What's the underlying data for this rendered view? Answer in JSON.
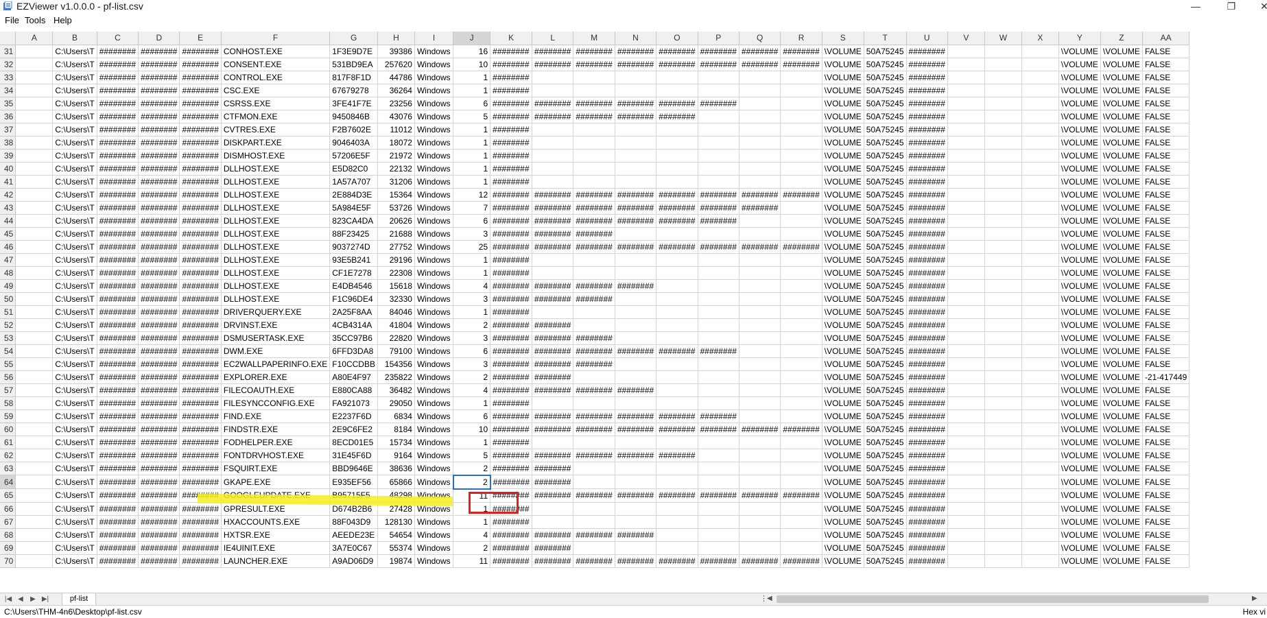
{
  "window": {
    "title": "EZViewer v1.0.0.0 - pf-list.csv",
    "controls": [
      "—",
      "❐",
      "✕"
    ]
  },
  "menu": [
    "File",
    "Tools",
    "Help"
  ],
  "columns": [
    "A",
    "B",
    "C",
    "D",
    "E",
    "F",
    "G",
    "H",
    "I",
    "J",
    "K",
    "L",
    "M",
    "N",
    "O",
    "P",
    "Q",
    "R",
    "S",
    "T",
    "U",
    "V",
    "W",
    "X",
    "Y",
    "Z",
    "AA"
  ],
  "active_column": "J",
  "active_row": "64",
  "rows": [
    [
      "31",
      "",
      "C:\\Users\\T",
      "########",
      "########",
      "########",
      "CONHOST.EXE",
      "1F3E9D7E",
      "39386",
      "Windows",
      "16",
      "########",
      "########",
      "########",
      "########",
      "########",
      "########",
      "########",
      "########",
      "\\VOLUME",
      "50A75245",
      "########",
      "",
      "",
      "",
      "\\VOLUME",
      "\\VOLUME",
      "FALSE"
    ],
    [
      "32",
      "",
      "C:\\Users\\T",
      "########",
      "########",
      "########",
      "CONSENT.EXE",
      "531BD9EA",
      "257620",
      "Windows",
      "10",
      "########",
      "########",
      "########",
      "########",
      "########",
      "########",
      "########",
      "########",
      "\\VOLUME",
      "50A75245",
      "########",
      "",
      "",
      "",
      "\\VOLUME",
      "\\VOLUME",
      "FALSE"
    ],
    [
      "33",
      "",
      "C:\\Users\\T",
      "########",
      "########",
      "########",
      "CONTROL.EXE",
      "817F8F1D",
      "44786",
      "Windows",
      "1",
      "########",
      "",
      "",
      "",
      "",
      "",
      "",
      "",
      "\\VOLUME",
      "50A75245",
      "########",
      "",
      "",
      "",
      "\\VOLUME",
      "\\VOLUME",
      "FALSE"
    ],
    [
      "34",
      "",
      "C:\\Users\\T",
      "########",
      "########",
      "########",
      "CSC.EXE",
      "67679278",
      "36264",
      "Windows",
      "1",
      "########",
      "",
      "",
      "",
      "",
      "",
      "",
      "",
      "\\VOLUME",
      "50A75245",
      "########",
      "",
      "",
      "",
      "\\VOLUME",
      "\\VOLUME",
      "FALSE"
    ],
    [
      "35",
      "",
      "C:\\Users\\T",
      "########",
      "########",
      "########",
      "CSRSS.EXE",
      "3FE41F7E",
      "23256",
      "Windows",
      "6",
      "########",
      "########",
      "########",
      "########",
      "########",
      "########",
      "",
      "",
      "\\VOLUME",
      "50A75245",
      "########",
      "",
      "",
      "",
      "\\VOLUME",
      "\\VOLUME",
      "FALSE"
    ],
    [
      "36",
      "",
      "C:\\Users\\T",
      "########",
      "########",
      "########",
      "CTFMON.EXE",
      "9450846B",
      "43076",
      "Windows",
      "5",
      "########",
      "########",
      "########",
      "########",
      "########",
      "",
      "",
      "",
      "\\VOLUME",
      "50A75245",
      "########",
      "",
      "",
      "",
      "\\VOLUME",
      "\\VOLUME",
      "FALSE"
    ],
    [
      "37",
      "",
      "C:\\Users\\T",
      "########",
      "########",
      "########",
      "CVTRES.EXE",
      "F2B7602E",
      "11012",
      "Windows",
      "1",
      "########",
      "",
      "",
      "",
      "",
      "",
      "",
      "",
      "\\VOLUME",
      "50A75245",
      "########",
      "",
      "",
      "",
      "\\VOLUME",
      "\\VOLUME",
      "FALSE"
    ],
    [
      "38",
      "",
      "C:\\Users\\T",
      "########",
      "########",
      "########",
      "DISKPART.EXE",
      "9046403A",
      "18072",
      "Windows",
      "1",
      "########",
      "",
      "",
      "",
      "",
      "",
      "",
      "",
      "\\VOLUME",
      "50A75245",
      "########",
      "",
      "",
      "",
      "\\VOLUME",
      "\\VOLUME",
      "FALSE"
    ],
    [
      "39",
      "",
      "C:\\Users\\T",
      "########",
      "########",
      "########",
      "DISMHOST.EXE",
      "57206E5F",
      "21972",
      "Windows",
      "1",
      "########",
      "",
      "",
      "",
      "",
      "",
      "",
      "",
      "\\VOLUME",
      "50A75245",
      "########",
      "",
      "",
      "",
      "\\VOLUME",
      "\\VOLUME",
      "FALSE"
    ],
    [
      "40",
      "",
      "C:\\Users\\T",
      "########",
      "########",
      "########",
      "DLLHOST.EXE",
      "E5D82C0",
      "22132",
      "Windows",
      "1",
      "########",
      "",
      "",
      "",
      "",
      "",
      "",
      "",
      "\\VOLUME",
      "50A75245",
      "########",
      "",
      "",
      "",
      "\\VOLUME",
      "\\VOLUME",
      "FALSE"
    ],
    [
      "41",
      "",
      "C:\\Users\\T",
      "########",
      "########",
      "########",
      "DLLHOST.EXE",
      "1A57A707",
      "31206",
      "Windows",
      "1",
      "########",
      "",
      "",
      "",
      "",
      "",
      "",
      "",
      "\\VOLUME",
      "50A75245",
      "########",
      "",
      "",
      "",
      "\\VOLUME",
      "\\VOLUME",
      "FALSE"
    ],
    [
      "42",
      "",
      "C:\\Users\\T",
      "########",
      "########",
      "########",
      "DLLHOST.EXE",
      "2E884D3E",
      "15364",
      "Windows",
      "12",
      "########",
      "########",
      "########",
      "########",
      "########",
      "########",
      "########",
      "########",
      "\\VOLUME",
      "50A75245",
      "########",
      "",
      "",
      "",
      "\\VOLUME",
      "\\VOLUME",
      "FALSE"
    ],
    [
      "43",
      "",
      "C:\\Users\\T",
      "########",
      "########",
      "########",
      "DLLHOST.EXE",
      "5A984E5F",
      "53726",
      "Windows",
      "7",
      "########",
      "########",
      "########",
      "########",
      "########",
      "########",
      "########",
      "",
      "\\VOLUME",
      "50A75245",
      "########",
      "",
      "",
      "",
      "\\VOLUME",
      "\\VOLUME",
      "FALSE"
    ],
    [
      "44",
      "",
      "C:\\Users\\T",
      "########",
      "########",
      "########",
      "DLLHOST.EXE",
      "823CA4DA",
      "20626",
      "Windows",
      "6",
      "########",
      "########",
      "########",
      "########",
      "########",
      "########",
      "",
      "",
      "\\VOLUME",
      "50A75245",
      "########",
      "",
      "",
      "",
      "\\VOLUME",
      "\\VOLUME",
      "FALSE"
    ],
    [
      "45",
      "",
      "C:\\Users\\T",
      "########",
      "########",
      "########",
      "DLLHOST.EXE",
      "88F23425",
      "21688",
      "Windows",
      "3",
      "########",
      "########",
      "########",
      "",
      "",
      "",
      "",
      "",
      "\\VOLUME",
      "50A75245",
      "########",
      "",
      "",
      "",
      "\\VOLUME",
      "\\VOLUME",
      "FALSE"
    ],
    [
      "46",
      "",
      "C:\\Users\\T",
      "########",
      "########",
      "########",
      "DLLHOST.EXE",
      "9037274D",
      "27752",
      "Windows",
      "25",
      "########",
      "########",
      "########",
      "########",
      "########",
      "########",
      "########",
      "########",
      "\\VOLUME",
      "50A75245",
      "########",
      "",
      "",
      "",
      "\\VOLUME",
      "\\VOLUME",
      "FALSE"
    ],
    [
      "47",
      "",
      "C:\\Users\\T",
      "########",
      "########",
      "########",
      "DLLHOST.EXE",
      "93E5B241",
      "29196",
      "Windows",
      "1",
      "########",
      "",
      "",
      "",
      "",
      "",
      "",
      "",
      "\\VOLUME",
      "50A75245",
      "########",
      "",
      "",
      "",
      "\\VOLUME",
      "\\VOLUME",
      "FALSE"
    ],
    [
      "48",
      "",
      "C:\\Users\\T",
      "########",
      "########",
      "########",
      "DLLHOST.EXE",
      "CF1E7278",
      "22308",
      "Windows",
      "1",
      "########",
      "",
      "",
      "",
      "",
      "",
      "",
      "",
      "\\VOLUME",
      "50A75245",
      "########",
      "",
      "",
      "",
      "\\VOLUME",
      "\\VOLUME",
      "FALSE"
    ],
    [
      "49",
      "",
      "C:\\Users\\T",
      "########",
      "########",
      "########",
      "DLLHOST.EXE",
      "E4DB4546",
      "15618",
      "Windows",
      "4",
      "########",
      "########",
      "########",
      "########",
      "",
      "",
      "",
      "",
      "\\VOLUME",
      "50A75245",
      "########",
      "",
      "",
      "",
      "\\VOLUME",
      "\\VOLUME",
      "FALSE"
    ],
    [
      "50",
      "",
      "C:\\Users\\T",
      "########",
      "########",
      "########",
      "DLLHOST.EXE",
      "F1C96DE4",
      "32330",
      "Windows",
      "3",
      "########",
      "########",
      "########",
      "",
      "",
      "",
      "",
      "",
      "\\VOLUME",
      "50A75245",
      "########",
      "",
      "",
      "",
      "\\VOLUME",
      "\\VOLUME",
      "FALSE"
    ],
    [
      "51",
      "",
      "C:\\Users\\T",
      "########",
      "########",
      "########",
      "DRIVERQUERY.EXE",
      "2A25F8AA",
      "84046",
      "Windows",
      "1",
      "########",
      "",
      "",
      "",
      "",
      "",
      "",
      "",
      "\\VOLUME",
      "50A75245",
      "########",
      "",
      "",
      "",
      "\\VOLUME",
      "\\VOLUME",
      "FALSE"
    ],
    [
      "52",
      "",
      "C:\\Users\\T",
      "########",
      "########",
      "########",
      "DRVINST.EXE",
      "4CB4314A",
      "41804",
      "Windows",
      "2",
      "########",
      "########",
      "",
      "",
      "",
      "",
      "",
      "",
      "\\VOLUME",
      "50A75245",
      "########",
      "",
      "",
      "",
      "\\VOLUME",
      "\\VOLUME",
      "FALSE"
    ],
    [
      "53",
      "",
      "C:\\Users\\T",
      "########",
      "########",
      "########",
      "DSMUSERTASK.EXE",
      "35CC97B6",
      "22820",
      "Windows",
      "3",
      "########",
      "########",
      "########",
      "",
      "",
      "",
      "",
      "",
      "\\VOLUME",
      "50A75245",
      "########",
      "",
      "",
      "",
      "\\VOLUME",
      "\\VOLUME",
      "FALSE"
    ],
    [
      "54",
      "",
      "C:\\Users\\T",
      "########",
      "########",
      "########",
      "DWM.EXE",
      "6FFD3DA8",
      "79100",
      "Windows",
      "6",
      "########",
      "########",
      "########",
      "########",
      "########",
      "########",
      "",
      "",
      "\\VOLUME",
      "50A75245",
      "########",
      "",
      "",
      "",
      "\\VOLUME",
      "\\VOLUME",
      "FALSE"
    ],
    [
      "55",
      "",
      "C:\\Users\\T",
      "########",
      "########",
      "########",
      "EC2WALLPAPERINFO.EXE",
      "F10CCDBB",
      "154356",
      "Windows",
      "3",
      "########",
      "########",
      "########",
      "",
      "",
      "",
      "",
      "",
      "\\VOLUME",
      "50A75245",
      "########",
      "",
      "",
      "",
      "\\VOLUME",
      "\\VOLUME",
      "FALSE"
    ],
    [
      "56",
      "",
      "C:\\Users\\T",
      "########",
      "########",
      "########",
      "EXPLORER.EXE",
      "A80E4F97",
      "235822",
      "Windows",
      "2",
      "########",
      "########",
      "",
      "",
      "",
      "",
      "",
      "",
      "\\VOLUME",
      "50A75245",
      "########",
      "",
      "",
      "",
      "\\VOLUME",
      "\\VOLUME",
      "-21-417449"
    ],
    [
      "57",
      "",
      "C:\\Users\\T",
      "########",
      "########",
      "########",
      "FILECOAUTH.EXE",
      "E880CA88",
      "36482",
      "Windows",
      "4",
      "########",
      "########",
      "########",
      "########",
      "",
      "",
      "",
      "",
      "\\VOLUME",
      "50A75245",
      "########",
      "",
      "",
      "",
      "\\VOLUME",
      "\\VOLUME",
      "FALSE"
    ],
    [
      "58",
      "",
      "C:\\Users\\T",
      "########",
      "########",
      "########",
      "FILESYNCCONFIG.EXE",
      "FA921073",
      "29050",
      "Windows",
      "1",
      "########",
      "",
      "",
      "",
      "",
      "",
      "",
      "",
      "\\VOLUME",
      "50A75245",
      "########",
      "",
      "",
      "",
      "\\VOLUME",
      "\\VOLUME",
      "FALSE"
    ],
    [
      "59",
      "",
      "C:\\Users\\T",
      "########",
      "########",
      "########",
      "FIND.EXE",
      "E2237F6D",
      "6834",
      "Windows",
      "6",
      "########",
      "########",
      "########",
      "########",
      "########",
      "########",
      "",
      "",
      "\\VOLUME",
      "50A75245",
      "########",
      "",
      "",
      "",
      "\\VOLUME",
      "\\VOLUME",
      "FALSE"
    ],
    [
      "60",
      "",
      "C:\\Users\\T",
      "########",
      "########",
      "########",
      "FINDSTR.EXE",
      "2E9C6FE2",
      "8184",
      "Windows",
      "10",
      "########",
      "########",
      "########",
      "########",
      "########",
      "########",
      "########",
      "########",
      "\\VOLUME",
      "50A75245",
      "########",
      "",
      "",
      "",
      "\\VOLUME",
      "\\VOLUME",
      "FALSE"
    ],
    [
      "61",
      "",
      "C:\\Users\\T",
      "########",
      "########",
      "########",
      "FODHELPER.EXE",
      "8ECD01E5",
      "15734",
      "Windows",
      "1",
      "########",
      "",
      "",
      "",
      "",
      "",
      "",
      "",
      "\\VOLUME",
      "50A75245",
      "########",
      "",
      "",
      "",
      "\\VOLUME",
      "\\VOLUME",
      "FALSE"
    ],
    [
      "62",
      "",
      "C:\\Users\\T",
      "########",
      "########",
      "########",
      "FONTDRVHOST.EXE",
      "31E45F6D",
      "9164",
      "Windows",
      "5",
      "########",
      "########",
      "########",
      "########",
      "########",
      "",
      "",
      "",
      "\\VOLUME",
      "50A75245",
      "########",
      "",
      "",
      "",
      "\\VOLUME",
      "\\VOLUME",
      "FALSE"
    ],
    [
      "63",
      "",
      "C:\\Users\\T",
      "########",
      "########",
      "########",
      "FSQUIRT.EXE",
      "BBD9646E",
      "38636",
      "Windows",
      "2",
      "########",
      "########",
      "",
      "",
      "",
      "",
      "",
      "",
      "\\VOLUME",
      "50A75245",
      "########",
      "",
      "",
      "",
      "\\VOLUME",
      "\\VOLUME",
      "FALSE"
    ],
    [
      "64",
      "",
      "C:\\Users\\T",
      "########",
      "########",
      "########",
      "GKAPE.EXE",
      "E935EF56",
      "65866",
      "Windows",
      "2",
      "########",
      "########",
      "",
      "",
      "",
      "",
      "",
      "",
      "\\VOLUME",
      "50A75245",
      "########",
      "",
      "",
      "",
      "\\VOLUME",
      "\\VOLUME",
      "FALSE"
    ],
    [
      "65",
      "",
      "C:\\Users\\T",
      "########",
      "########",
      "########",
      "GOOGLEUPDATE.EXE",
      "B95715F5",
      "48298",
      "Windows",
      "11",
      "########",
      "########",
      "########",
      "########",
      "########",
      "########",
      "########",
      "########",
      "\\VOLUME",
      "50A75245",
      "########",
      "",
      "",
      "",
      "\\VOLUME",
      "\\VOLUME",
      "FALSE"
    ],
    [
      "66",
      "",
      "C:\\Users\\T",
      "########",
      "########",
      "########",
      "GPRESULT.EXE",
      "D674B2B6",
      "27428",
      "Windows",
      "1",
      "########",
      "",
      "",
      "",
      "",
      "",
      "",
      "",
      "\\VOLUME",
      "50A75245",
      "########",
      "",
      "",
      "",
      "\\VOLUME",
      "\\VOLUME",
      "FALSE"
    ],
    [
      "67",
      "",
      "C:\\Users\\T",
      "########",
      "########",
      "########",
      "HXACCOUNTS.EXE",
      "88F043D9",
      "128130",
      "Windows",
      "1",
      "########",
      "",
      "",
      "",
      "",
      "",
      "",
      "",
      "\\VOLUME",
      "50A75245",
      "########",
      "",
      "",
      "",
      "\\VOLUME",
      "\\VOLUME",
      "FALSE"
    ],
    [
      "68",
      "",
      "C:\\Users\\T",
      "########",
      "########",
      "########",
      "HXTSR.EXE",
      "AEEDE23E",
      "54654",
      "Windows",
      "4",
      "########",
      "########",
      "########",
      "########",
      "",
      "",
      "",
      "",
      "\\VOLUME",
      "50A75245",
      "########",
      "",
      "",
      "",
      "\\VOLUME",
      "\\VOLUME",
      "FALSE"
    ],
    [
      "69",
      "",
      "C:\\Users\\T",
      "########",
      "########",
      "########",
      "IE4UINIT.EXE",
      "3A7E0C67",
      "55374",
      "Windows",
      "2",
      "########",
      "########",
      "",
      "",
      "",
      "",
      "",
      "",
      "\\VOLUME",
      "50A75245",
      "########",
      "",
      "",
      "",
      "\\VOLUME",
      "\\VOLUME",
      "FALSE"
    ],
    [
      "70",
      "",
      "C:\\Users\\T",
      "########",
      "########",
      "########",
      "LAUNCHER.EXE",
      "A9AD06D9",
      "19874",
      "Windows",
      "11",
      "########",
      "########",
      "########",
      "########",
      "########",
      "########",
      "########",
      "########",
      "\\VOLUME",
      "50A75245",
      "########",
      "",
      "",
      "",
      "\\VOLUME",
      "\\VOLUME",
      "FALSE"
    ]
  ],
  "sheet_tab": "pf-list",
  "sheet_nav": [
    "|◀",
    "◀",
    "▶",
    "▶|"
  ],
  "status": {
    "path": "C:\\Users\\THM-4n6\\Desktop\\pf-list.csv",
    "right": "Hex vi"
  },
  "colors": {
    "highlight": "#f4ef1e",
    "annotation_box": "#e02020",
    "selection": "#2a6fbd"
  }
}
